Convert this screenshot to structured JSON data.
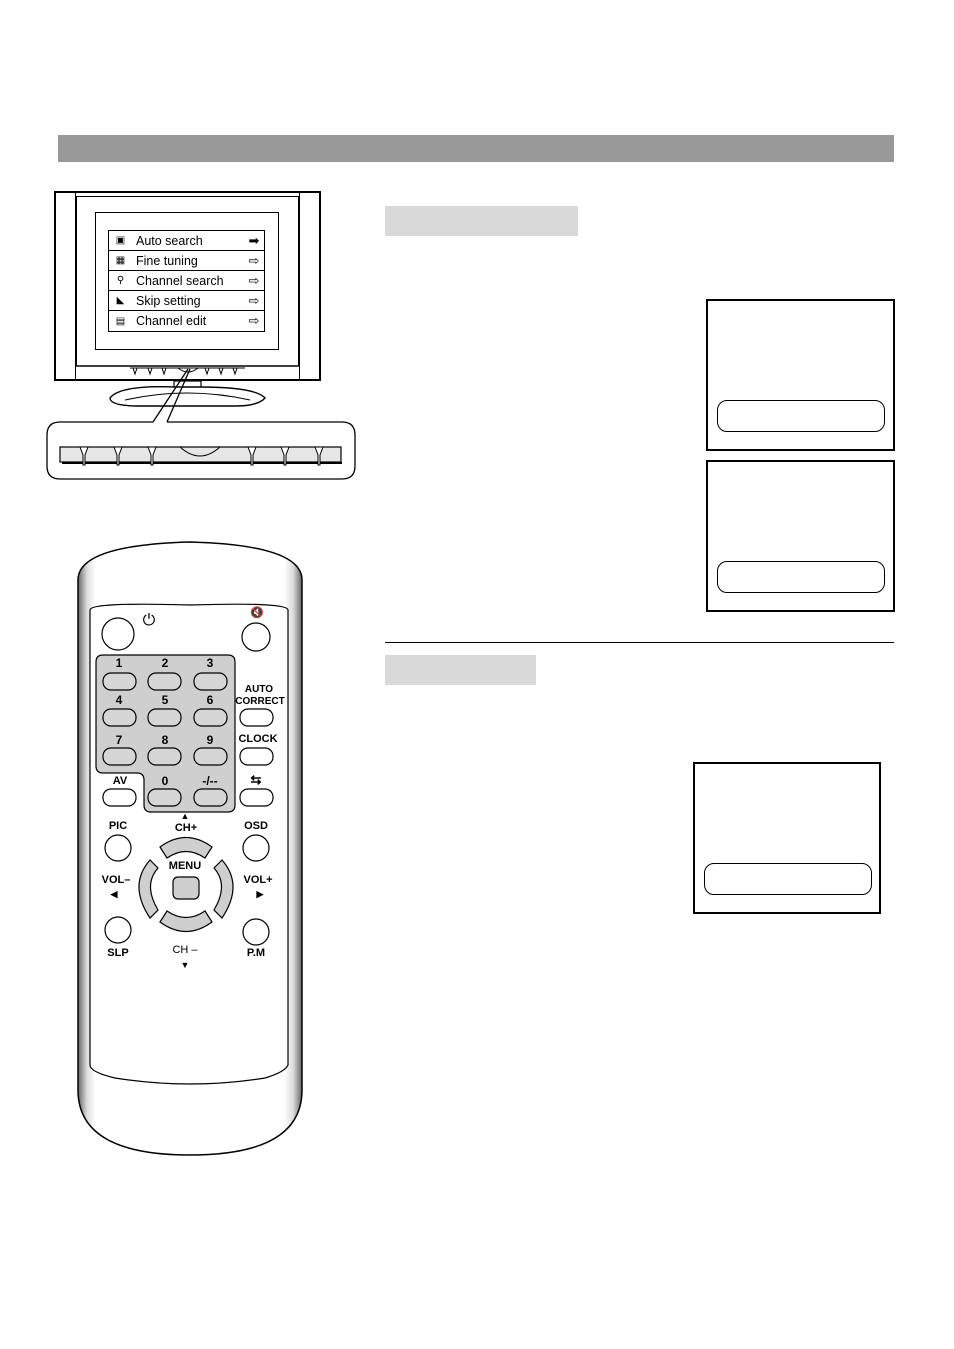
{
  "page": {
    "header_bar_color": "#999999",
    "section_tab_color": "#d9d9d9"
  },
  "tv_menu": {
    "items": [
      {
        "icon": "auto-search-icon",
        "label": "Auto search",
        "arrow": "➡",
        "selected": true
      },
      {
        "icon": "fine-tuning-icon",
        "label": "Fine tuning",
        "arrow": "⇨",
        "selected": false
      },
      {
        "icon": "channel-search-icon",
        "label": "Channel search",
        "arrow": "⇨",
        "selected": false
      },
      {
        "icon": "skip-setting-icon",
        "label": "Skip setting",
        "arrow": "⇨",
        "selected": false
      },
      {
        "icon": "channel-edit-icon",
        "label": "Channel edit",
        "arrow": "⇨",
        "selected": false
      }
    ],
    "icon_glyphs": [
      "▣",
      "▦",
      "⚲",
      "◣",
      "▤"
    ]
  },
  "remote": {
    "power_icon": "⏻",
    "mute_icon": "🔇",
    "numbers": [
      "1",
      "2",
      "3",
      "4",
      "5",
      "6",
      "7",
      "8",
      "9",
      "0",
      "-/--"
    ],
    "auto_correct": "AUTO\nCORRECT",
    "auto_line1": "AUTO",
    "auto_line2": "CORRECT",
    "clock": "CLOCK",
    "av": "AV",
    "swap_icon": "⇆",
    "pic": "PIC",
    "osd": "OSD",
    "ch_up": "CH+",
    "ch_down": "CH –",
    "menu": "MENU",
    "vol_down": "VOL–",
    "vol_up": "VOL+",
    "slp": "SLP",
    "pm": "P.M",
    "up_arrow": "▲",
    "down_arrow": "▼",
    "left_arrow": "◀",
    "right_arrow": "▶"
  }
}
